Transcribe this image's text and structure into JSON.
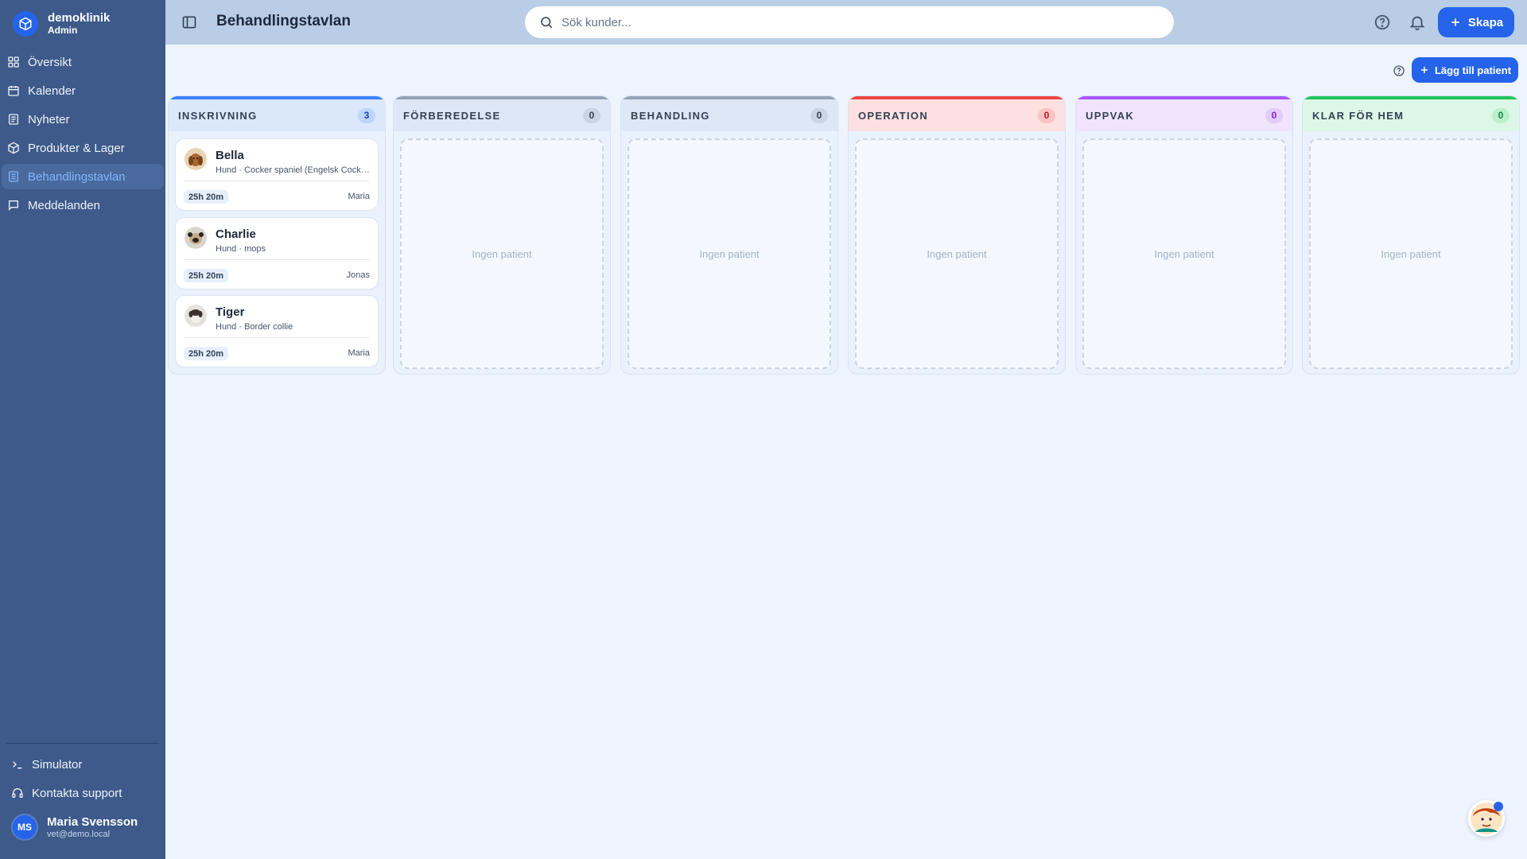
{
  "brand": {
    "name": "demoklinik",
    "role": "Admin"
  },
  "nav": [
    {
      "label": "Översikt",
      "icon": "grid-icon"
    },
    {
      "label": "Kalender",
      "icon": "calendar-icon"
    },
    {
      "label": "Nyheter",
      "icon": "news-icon"
    },
    {
      "label": "Produkter & Lager",
      "icon": "box-icon"
    },
    {
      "label": "Behandlingstavlan",
      "icon": "board-icon",
      "active": true
    },
    {
      "label": "Meddelanden",
      "icon": "message-icon"
    }
  ],
  "side_bottom": {
    "simulator": "Simulator",
    "support": "Kontakta support"
  },
  "user": {
    "initials": "MS",
    "name": "Maria Svensson",
    "email": "vet@demo.local"
  },
  "header": {
    "title": "Behandlingstavlan",
    "search_placeholder": "Sök kunder...",
    "create_label": "Skapa"
  },
  "actions": {
    "add_patient": "Lägg till patient"
  },
  "empty_text": "Ingen patient",
  "columns": [
    {
      "title": "INSKRIVNING",
      "count": "3",
      "accent": "#3b82f6"
    },
    {
      "title": "FÖRBEREDELSE",
      "count": "0",
      "accent": "#94a3b8"
    },
    {
      "title": "BEHANDLING",
      "count": "0",
      "accent": "#94a3b8"
    },
    {
      "title": "OPERATION",
      "count": "0",
      "accent": "#ef4444"
    },
    {
      "title": "UPPVAK",
      "count": "0",
      "accent": "#a855f7"
    },
    {
      "title": "KLAR FÖR HEM",
      "count": "0",
      "accent": "#22c55e"
    }
  ],
  "patients": [
    {
      "name": "Bella",
      "details": "Hund · Cocker spaniel (Engelsk Cocker spaniel)",
      "time": "25h 20m",
      "owner": "Maria"
    },
    {
      "name": "Charlie",
      "details": "Hund · mops",
      "time": "25h 20m",
      "owner": "Jonas"
    },
    {
      "name": "Tiger",
      "details": "Hund · Border collie",
      "time": "25h 20m",
      "owner": "Maria"
    }
  ]
}
